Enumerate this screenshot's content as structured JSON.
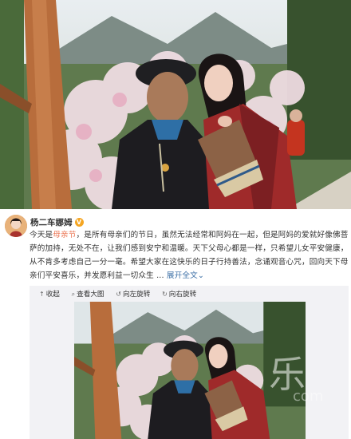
{
  "post": {
    "username": "杨二车娜姆",
    "verified_badge": "V",
    "text_part1": "今天是",
    "text_highlight": "母亲节",
    "text_part2": "，是所有母亲们的节日，虽然无法经常和阿妈在一起，但是阿妈的爱就好像佛菩萨的加持，无处不在，让我们感到安宁和温暖。天下父母心都是一样，只希望儿女平安健康，从不肯多考虑自己一分一毫。希望大家在这快乐的日子行持善法，念诵观音心咒，回向天下母亲们平安喜乐，并发愿利益一切众生 ...",
    "expand_label": "展开全文",
    "expand_icon": "chevron-down-icon"
  },
  "toolbar": {
    "collapse_label": "收起",
    "view_large_label": "查看大图",
    "rotate_left_label": "向左旋转",
    "rotate_right_label": "向右旋转"
  },
  "watermark": {
    "char": "乐",
    "url": "com"
  },
  "colors": {
    "highlight": "#eb7350",
    "link": "#3a6ea5",
    "media_bg": "#f2f2f5",
    "badge": "#f5a623"
  }
}
